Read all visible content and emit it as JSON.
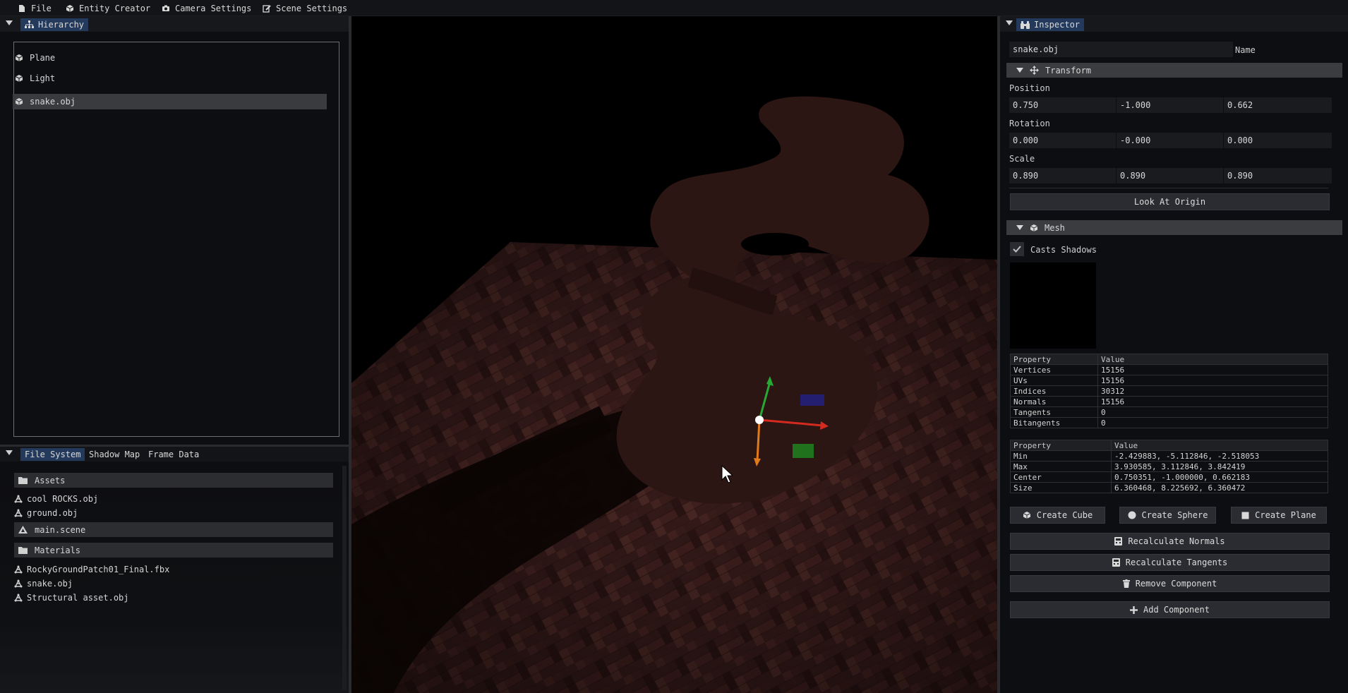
{
  "menu": {
    "file": "File",
    "entity_creator": "Entity Creator",
    "camera_settings": "Camera Settings",
    "scene_settings": "Scene Settings"
  },
  "hierarchy": {
    "tab": "Hierarchy",
    "items": [
      "Plane",
      "Light",
      "snake.obj"
    ],
    "selected": "snake.obj"
  },
  "bottom_tabs": [
    "File System",
    "Shadow Map",
    "Frame Data"
  ],
  "file_system": {
    "assets_folder": "Assets",
    "assets_files": [
      "cool ROCKS.obj",
      "ground.obj"
    ],
    "scene_file": "main.scene",
    "materials_folder": "Materials",
    "materials_files": [
      "RockyGroundPatch01_Final.fbx",
      "snake.obj",
      "Structural asset.obj"
    ]
  },
  "inspector": {
    "tab": "Inspector",
    "name_value": "snake.obj",
    "name_label": "Name",
    "transform": {
      "header": "Transform",
      "position_label": "Position",
      "position": [
        "0.750",
        "-1.000",
        "0.662"
      ],
      "rotation_label": "Rotation",
      "rotation": [
        "0.000",
        "-0.000",
        "0.000"
      ],
      "scale_label": "Scale",
      "scale": [
        "0.890",
        "0.890",
        "0.890"
      ],
      "look_at_origin": "Look At Origin"
    },
    "mesh": {
      "header": "Mesh",
      "casts_shadows_label": "Casts Shadows",
      "casts_shadows": true,
      "stats_header": [
        "Property",
        "Value"
      ],
      "stats": [
        [
          "Vertices",
          "15156"
        ],
        [
          "UVs",
          "15156"
        ],
        [
          "Indices",
          "30312"
        ],
        [
          "Normals",
          "15156"
        ],
        [
          "Tangents",
          "0"
        ],
        [
          "Bitangents",
          "0"
        ]
      ],
      "bounds_header": [
        "Property",
        "Value"
      ],
      "bounds": [
        [
          "Min",
          "-2.429883, -5.112846, -2.518053"
        ],
        [
          "Max",
          "3.930585, 3.112846, 3.842419"
        ],
        [
          "Center",
          "0.750351, -1.000000, 0.662183"
        ],
        [
          "Size",
          "6.360468, 8.225692, 6.360472"
        ]
      ]
    },
    "buttons": {
      "create_cube": "Create Cube",
      "create_sphere": "Create Sphere",
      "create_plane": "Create Plane",
      "recalc_normals": "Recalculate Normals",
      "recalc_tangents": "Recalculate Tangents",
      "remove_component": "Remove Component",
      "add_component": "Add Component"
    }
  },
  "colors": {
    "accent_tab": "#233a5c",
    "panel_bg": "#0d0e11",
    "gizmo_x": "#d42a20",
    "gizmo_y": "#28a834",
    "gizmo_z": "#e07a1a"
  }
}
